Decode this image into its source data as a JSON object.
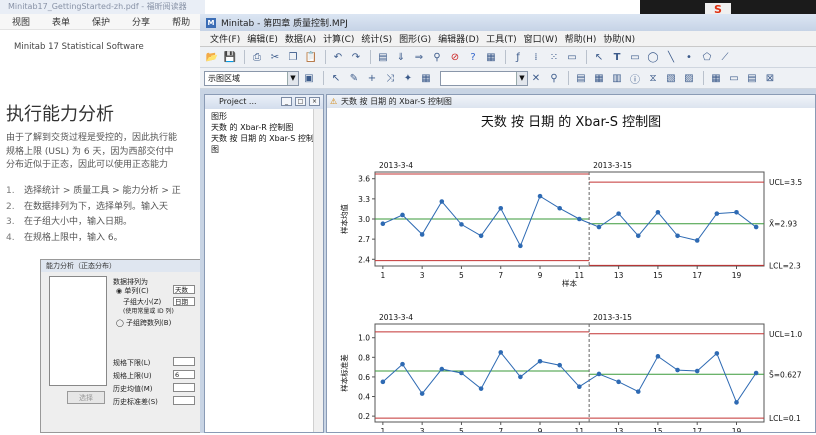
{
  "background_doc": {
    "title_bar": "Minitab17_GettingStarted-zh.pdf - 福昕阅读器",
    "menu": [
      "视图",
      "表单",
      "保护",
      "分享",
      "帮助"
    ],
    "software_name": "Minitab 17 Statistical Software",
    "heading": "执行能力分析",
    "paragraph_lines": [
      "由于了解到交货过程是受控的，因此执行能",
      "规格上限 (USL) 为 6 天，因为西部交付中",
      "分布近似于正态，因此可以使用正态能力"
    ],
    "steps": [
      {
        "num": "1.",
        "text": "选择统计 > 质量工具 > 能力分析 > 正"
      },
      {
        "num": "2.",
        "text": "在数据排列为下，选择单列。输入天"
      },
      {
        "num": "3.",
        "text": "在子组大小中，输入日期。"
      },
      {
        "num": "4.",
        "text": "在规格上限中，输入 6。"
      }
    ]
  },
  "dialog": {
    "title": "能力分析（正态分布）",
    "data_arrangement_label": "数据排列为",
    "single_column_label": "◉ 单列(C)",
    "single_column_value": "天数",
    "subgroup_size_label": "子组大小(Z)",
    "subgroup_size_hint": "(使用常量或 ID 列)",
    "subgroup_value": "日期",
    "subgroup_across_label": "◯ 子组跨数列(B)",
    "lsl_label": "规格下限(L)",
    "usl_label": "规格上限(U)",
    "usl_value": "6",
    "hist_mean_label": "历史均值(M)",
    "hist_std_label": "历史标准差(S)",
    "select_button": "选择"
  },
  "minitab": {
    "title": "Minitab - 第四章 质量控制.MPJ",
    "menu": [
      "文件(F)",
      "编辑(E)",
      "数据(A)",
      "计算(C)",
      "统计(S)",
      "图形(G)",
      "编辑器(D)",
      "工具(T)",
      "窗口(W)",
      "帮助(H)",
      "协助(N)"
    ],
    "toolbar_select": "示图区域",
    "toolbar_select2": "",
    "project_panel": {
      "title": "Project ...",
      "items": [
        "图形",
        "天数 的 Xbar-R 控制图",
        "天数 按 日期 的 Xbar-S 控制图"
      ]
    },
    "graph_window_title": "天数 按 日期 的 Xbar-S 控制图"
  },
  "chart_data": {
    "type": "line",
    "title": "天数 按 日期 的 Xbar-S 控制图",
    "stages": [
      "2013-3-4",
      "2013-3-15"
    ],
    "xlabel": "样本",
    "x": [
      1,
      2,
      3,
      4,
      5,
      6,
      7,
      8,
      9,
      10,
      11,
      12,
      13,
      14,
      15,
      16,
      17,
      18,
      19,
      20
    ],
    "x_ticks": [
      1,
      3,
      5,
      7,
      9,
      11,
      13,
      15,
      17,
      19
    ],
    "stage_boundary": 11.5,
    "xbar": {
      "ylabel": "样本均值",
      "ylim": [
        2.3,
        3.7
      ],
      "y_ticks": [
        "2.4",
        "2.7",
        "3.0",
        "3.3",
        "3.6"
      ],
      "values": [
        2.93,
        3.06,
        2.77,
        3.26,
        2.92,
        2.75,
        3.16,
        2.6,
        3.34,
        3.16,
        3.0,
        2.88,
        3.08,
        2.75,
        3.1,
        2.75,
        2.68,
        3.08,
        3.1,
        2.88
      ],
      "stage1": {
        "ucl": 3.67,
        "center": 3.0,
        "lcl": 2.38
      },
      "stage2": {
        "ucl": 3.55,
        "center": 2.93,
        "lcl": 2.31
      },
      "labels": {
        "ucl": "UCL=3.5",
        "center": "X̄=2.93",
        "lcl": "LCL=2.3"
      }
    },
    "s": {
      "ylabel": "样本标准差",
      "ylim": [
        0.14,
        1.14
      ],
      "y_ticks": [
        "0.2",
        "0.4",
        "0.6",
        "0.8",
        "1.0"
      ],
      "values": [
        0.55,
        0.73,
        0.43,
        0.68,
        0.64,
        0.48,
        0.85,
        0.6,
        0.76,
        0.72,
        0.5,
        0.63,
        0.55,
        0.45,
        0.81,
        0.67,
        0.66,
        0.84,
        0.34,
        0.64
      ],
      "stage1": {
        "ucl": 1.06,
        "center": 0.66,
        "lcl": 0.18
      },
      "stage2": {
        "ucl": 1.04,
        "center": 0.627,
        "lcl": 0.18
      },
      "labels": {
        "ucl": "UCL=1.0",
        "center": "S̄=0.627",
        "lcl": "LCL=0.1"
      }
    },
    "colors": {
      "series": "#2e6ab3",
      "center": "#3a9a3a",
      "limit": "#c33333",
      "divider": "#666666"
    }
  }
}
